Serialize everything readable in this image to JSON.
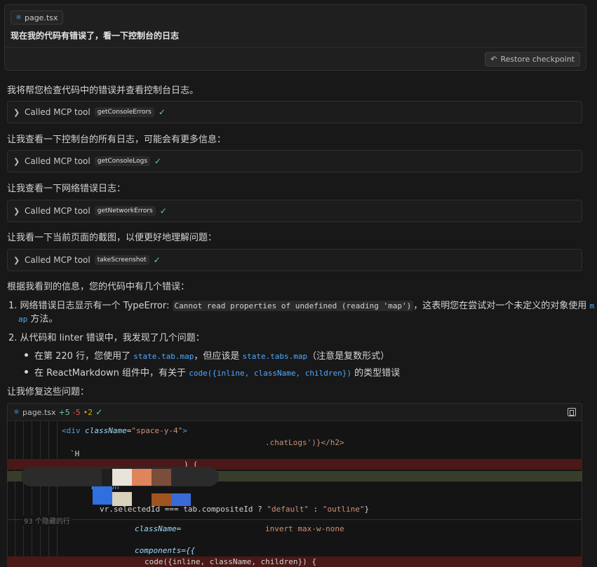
{
  "user_message": {
    "file_chip": "page.tsx",
    "text": "现在我的代码有错误了，看一下控制台的日志",
    "restore_label": "Restore checkpoint"
  },
  "assistant": {
    "intro": "我将帮您检查代码中的错误并查看控制台日志。",
    "p2": "让我查看一下控制台的所有日志，可能会有更多信息：",
    "p3": "让我查看一下网络错误日志：",
    "p4": "让我看一下当前页面的截图，以便更好地理解问题：",
    "p5": "根据我看到的信息，您的代码中有几个错误：",
    "p6": "让我修复这些问题：",
    "tool_prefix": "Called MCP tool",
    "tools": [
      "getConsoleErrors",
      "getConsoleLogs",
      "getNetworkErrors",
      "takeScreenshot"
    ],
    "item1_num": "1.",
    "item1_a": "网络错误日志显示有一个 TypeError: ",
    "item1_code": "Cannot read properties of undefined (reading 'map')",
    "item1_b": "，这表明您在尝试对一个未定义的对象使用",
    "item1_code2a": "m",
    "item1_code2b": "ap",
    "item1_c": " 方法。",
    "item2_num": "2.",
    "item2": "从代码和 linter 错误中，我发现了几个问题：",
    "sub1_a": "在第 220 行，您使用了 ",
    "sub1_code1": "state.tab.map",
    "sub1_b": "，但应该是 ",
    "sub1_code2": "state.tabs.map",
    "sub1_c": "（注意是复数形式）",
    "sub2_a": "在 ReactMarkdown 组件中，有关于 ",
    "sub2_code": "code({inline, className, children})",
    "sub2_b": " 的类型错误"
  },
  "diff": {
    "file": "page.tsx",
    "added": "+5",
    "removed": "-5",
    "warnings": "•2",
    "hidden_lines": "93 个隐藏的行",
    "lines": {
      "l1_tag": "<div ",
      "l1_attr": "className",
      "l1_eq": "=",
      "l1_str": "\"space-y-4\"",
      "l1_end": ">",
      "l2": ".chatLogs')}</h2>",
      "l3": "`H",
      "l4": ") (",
      "l5": "Button",
      "l6_a": "v",
      "l6_b": "r.selectedId === tab.compositeId ? ",
      "l6_c": "\"default\"",
      "l6_d": " : ",
      "l6_e": "\"outline\"",
      "l6_f": "}",
      "l7_a": "className=",
      "l7_b": "invert max-w-none",
      "l8": "components={{",
      "l9": "code({inline, className, children}) {"
    }
  },
  "icons": {
    "react": "react-icon",
    "restore": "restore-icon",
    "chevron": "chevron-right-icon",
    "check": "check-icon",
    "expand": "open-in-editor-icon"
  },
  "colors": {
    "added": "#73c991",
    "removed": "#f14c4c",
    "warning": "#cca700",
    "inline_code_link": "#4fa8ff"
  }
}
